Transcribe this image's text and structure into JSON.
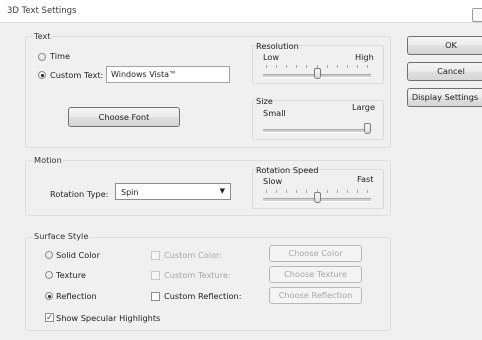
{
  "window": {
    "title": "3D Text Settings"
  },
  "text_group": {
    "label": "Text",
    "time_label": "Time",
    "custom_text_label": "Custom Text:",
    "custom_text_value": "Windows Vista™",
    "choose_font_label": "Choose Font",
    "selected_option": "custom_text"
  },
  "resolution": {
    "label": "Resolution",
    "min_label": "Low",
    "max_label": "High",
    "level": 0.5
  },
  "size": {
    "label": "Size",
    "min_label": "Small",
    "max_label": "Large",
    "level": 1.0
  },
  "motion_group": {
    "label": "Motion",
    "rotation_type_label": "Rotation Type:",
    "rotation_type_value": "Spin"
  },
  "rotation_speed": {
    "label": "Rotation Speed",
    "min_label": "Slow",
    "max_label": "Fast",
    "level": 0.5
  },
  "surface_group": {
    "label": "Surface Style",
    "solid_color_label": "Solid Color",
    "texture_label": "Texture",
    "reflection_label": "Reflection",
    "custom_color_label": "Custom Color:",
    "custom_texture_label": "Custom Texture:",
    "custom_reflection_label": "Custom Reflection:",
    "choose_color_label": "Choose Color",
    "choose_texture_label": "Choose Texture",
    "choose_reflection_label": "Choose Reflection",
    "show_specular_label": "Show Specular Highlights",
    "selected_style": "reflection",
    "show_specular_checked": true
  },
  "buttons": {
    "ok": "OK",
    "cancel": "Cancel",
    "display_settings": "Display Settings"
  },
  "icons": {
    "checkmark": "✓",
    "dropdown_arrow": "▼",
    "close": "close-icon"
  },
  "colors": {
    "window_bg": "#f0f0f0",
    "disabled_text": "#a6a6a6"
  }
}
